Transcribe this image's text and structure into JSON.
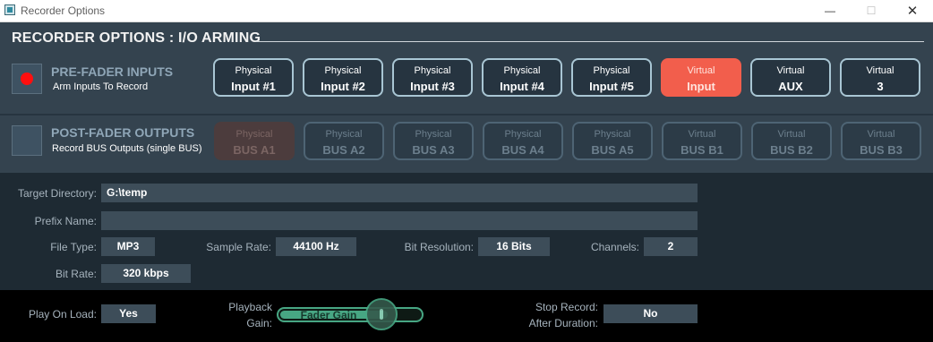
{
  "window": {
    "title": "Recorder Options"
  },
  "header": {
    "title": "RECORDER OPTIONS : I/O ARMING"
  },
  "pre_fader": {
    "title": "PRE-FADER INPUTS",
    "subtitle": "Arm Inputs To Record",
    "buttons": [
      {
        "kind": "Physical",
        "name": "Input #1",
        "state": "normal"
      },
      {
        "kind": "Physical",
        "name": "Input #2",
        "state": "normal"
      },
      {
        "kind": "Physical",
        "name": "Input #3",
        "state": "normal"
      },
      {
        "kind": "Physical",
        "name": "Input #4",
        "state": "normal"
      },
      {
        "kind": "Physical",
        "name": "Input #5",
        "state": "normal"
      },
      {
        "kind": "Virtual",
        "name": "Input",
        "state": "active"
      },
      {
        "kind": "Virtual",
        "name": "AUX",
        "state": "normal"
      },
      {
        "kind": "Virtual",
        "name": "3",
        "state": "normal"
      }
    ]
  },
  "post_fader": {
    "title": "POST-FADER OUTPUTS",
    "subtitle": "Record BUS Outputs (single BUS)",
    "buttons": [
      {
        "kind": "Physical",
        "name": "BUS A1",
        "state": "dim-active"
      },
      {
        "kind": "Physical",
        "name": "BUS A2",
        "state": "dim"
      },
      {
        "kind": "Physical",
        "name": "BUS A3",
        "state": "dim"
      },
      {
        "kind": "Physical",
        "name": "BUS A4",
        "state": "dim"
      },
      {
        "kind": "Physical",
        "name": "BUS A5",
        "state": "dim"
      },
      {
        "kind": "Virtual",
        "name": "BUS B1",
        "state": "dim"
      },
      {
        "kind": "Virtual",
        "name": "BUS B2",
        "state": "dim"
      },
      {
        "kind": "Virtual",
        "name": "BUS B3",
        "state": "dim"
      }
    ]
  },
  "settings": {
    "target_directory": {
      "label": "Target Directory:",
      "value": "G:\\temp"
    },
    "prefix_name": {
      "label": "Prefix Name:",
      "value": ""
    },
    "file_type": {
      "label": "File Type:",
      "value": "MP3"
    },
    "sample_rate": {
      "label": "Sample Rate:",
      "value": "44100 Hz"
    },
    "bit_resolution": {
      "label": "Bit Resolution:",
      "value": "16 Bits"
    },
    "channels": {
      "label": "Channels:",
      "value": "2"
    },
    "bit_rate": {
      "label": "Bit Rate:",
      "value": "320 kbps"
    }
  },
  "bottom": {
    "play_on_load": {
      "label": "Play On Load:",
      "value": "Yes"
    },
    "playback_gain": {
      "label_line1": "Playback",
      "label_line2": "Gain:",
      "slider_label": "Fader Gain",
      "level": 0.72
    },
    "stop_record": {
      "label_line1": "Stop Record:",
      "label_line2": "After Duration:",
      "value": "No"
    }
  },
  "colors": {
    "armed": "#f25e4c",
    "record_dot": "#ff0f0f",
    "slider": "#47a683"
  }
}
